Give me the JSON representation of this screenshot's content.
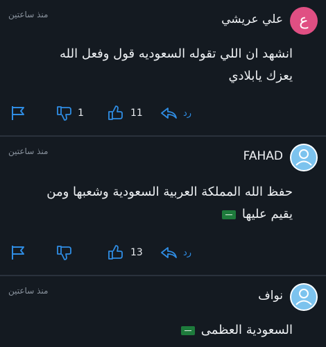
{
  "comments": [
    {
      "avatar_letter": "ع",
      "author": "علي عريشي",
      "time": "منذ ساعتين",
      "lines": [
        "انشهد ان اللي تقوله السعوديه قول وفعل الله",
        "يعزك يابلادي"
      ],
      "dislikes": "1",
      "likes": "11",
      "reply_label": "رد"
    },
    {
      "author": "FAHAD",
      "time": "منذ ساعتين",
      "lines": [
        "حفظ الله المملكة العربية السعودية وشعبها ومن",
        "يقيم عليها"
      ],
      "likes": "13",
      "reply_label": "رد"
    },
    {
      "author": "نواف",
      "time": "منذ ساعتين",
      "lines": [
        "السعودية العظمى"
      ]
    }
  ],
  "colors": {
    "background": "#141a21",
    "accent": "#2f8de4",
    "avatar_letter_bg": "#e04f83",
    "avatar_user_bg": "#7cc3ee"
  }
}
